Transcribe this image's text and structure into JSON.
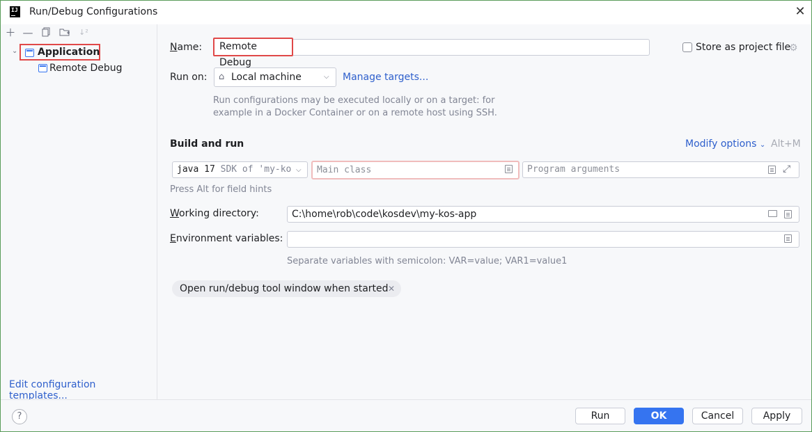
{
  "window": {
    "title": "Run/Debug Configurations",
    "app_icon_text": "IJ"
  },
  "sidebar": {
    "toolbar": [
      "add-icon",
      "remove-icon",
      "copy-icon",
      "new-folder-icon",
      "sort-icon"
    ],
    "tree": {
      "group_label": "Application",
      "children": [
        {
          "label": "Remote Debug"
        }
      ]
    },
    "edit_templates_link": "Edit configuration templates..."
  },
  "form": {
    "name_label_mnemonic": "N",
    "name_label_rest": "ame:",
    "name_value": "Remote Debug",
    "store_as_project_file": "Store as project file",
    "run_on_label": "Run on:",
    "run_on_value": "Local machine",
    "manage_targets": "Manage targets...",
    "run_on_hint_line1": "Run configurations may be executed locally or on a target: for",
    "run_on_hint_line2": "example in a Docker Container or on a remote host using SSH.",
    "build_and_run": "Build and run",
    "modify_options": "Modify options",
    "modify_options_shortcut": "Alt+M",
    "sdk_value": "java 17",
    "sdk_detail": "SDK of 'my-ko",
    "main_class_placeholder": "Main class",
    "program_args_placeholder": "Program arguments",
    "field_hints": "Press Alt for field hints",
    "working_dir_mnemonic": "W",
    "working_dir_rest": "orking directory:",
    "working_dir_value": "C:\\home\\rob\\code\\kosdev\\my-kos-app",
    "env_vars_mnemonic": "E",
    "env_vars_rest": "nvironment variables:",
    "env_vars_value": "",
    "env_vars_hint": "Separate variables with semicolon: VAR=value; VAR1=value1",
    "open_tool_window_chip": "Open run/debug tool window when started"
  },
  "footer": {
    "help": "?",
    "run": "Run",
    "ok": "OK",
    "cancel": "Cancel",
    "apply": "Apply"
  }
}
